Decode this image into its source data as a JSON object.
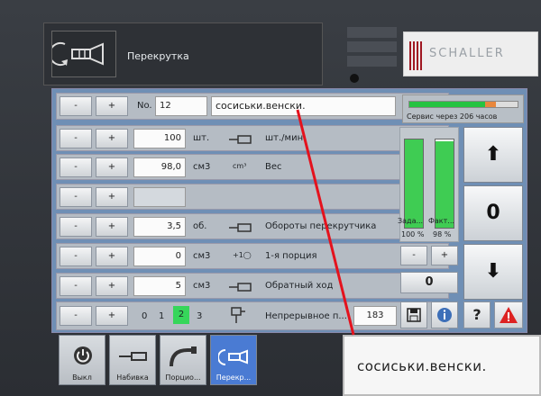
{
  "header": {
    "title": "Перекрутка",
    "status_lines": [
      "",
      "",
      ""
    ],
    "logo_text": "SCHALLER"
  },
  "product": {
    "minus": "-",
    "plus": "+",
    "no_label": "No.",
    "number": "12",
    "name": "сосиськи.венски."
  },
  "service": {
    "text": "Сервис через 206 часов",
    "fill_fraction": 0.7,
    "orange_fraction": 0.1
  },
  "rows": [
    {
      "minus": "-",
      "plus": "+",
      "value": "100",
      "unit": "шт.",
      "icon": "sausage-cutter-icon",
      "label": "шт./мин"
    },
    {
      "minus": "-",
      "plus": "+",
      "value": "98,0",
      "unit": "см3",
      "icon_text": "cm³",
      "label": "Вес"
    },
    {
      "minus": "-",
      "plus": "+",
      "value": "",
      "unit": "",
      "label": ""
    },
    {
      "minus": "-",
      "plus": "+",
      "value": "3,5",
      "unit": "об.",
      "icon": "twist-icon",
      "label": "Обороты перекрутчика"
    },
    {
      "minus": "-",
      "plus": "+",
      "value": "0",
      "unit": "см3",
      "icon_text": "+1◯",
      "label": "1-я порция"
    },
    {
      "minus": "-",
      "plus": "+",
      "value": "5",
      "unit": "см3",
      "icon": "reverse-icon",
      "label": "Обратный ход"
    }
  ],
  "last_row": {
    "minus": "-",
    "plus": "+",
    "options": [
      "0",
      "1",
      "2",
      "3"
    ],
    "selected": "2",
    "label": "Непрерывное п...",
    "count": "183"
  },
  "gauges": {
    "set_label": "Зада...",
    "actual_label": "Факт...",
    "set_value": "100 %",
    "actual_value": "98 %",
    "set_fraction": 1.0,
    "actual_fraction": 0.98
  },
  "side": {
    "up": "⬆",
    "zero": "0",
    "down": "⬇",
    "small_minus": "-",
    "small_plus": "+",
    "small_zero": "0",
    "help": "?",
    "warning": "!"
  },
  "tabs": [
    {
      "label": "Выкл",
      "icon": "power-off-icon"
    },
    {
      "label": "Набивка",
      "icon": "filling-icon"
    },
    {
      "label": "Порцио...",
      "icon": "portion-icon"
    },
    {
      "label": "Перекр...",
      "icon": "twist-tab-icon",
      "active": true
    }
  ],
  "zoom_text": "сосиськи.венски."
}
